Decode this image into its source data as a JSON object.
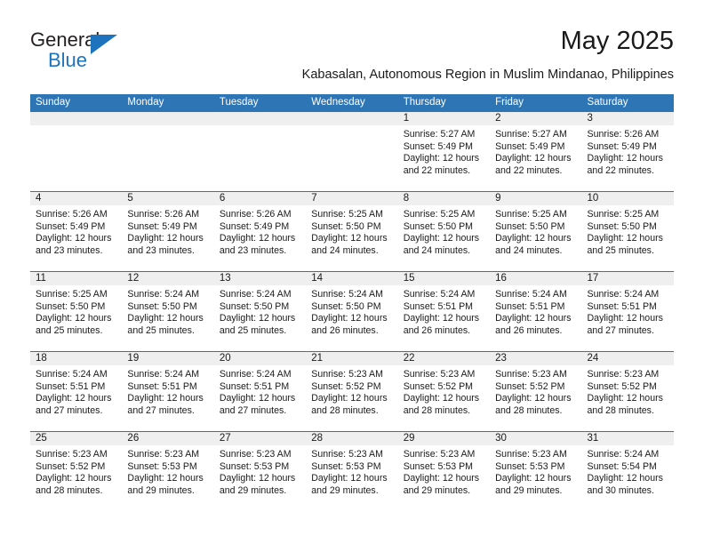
{
  "brand": {
    "name_part1": "General",
    "name_part2": "Blue",
    "accent_color": "#1e73be"
  },
  "header": {
    "title": "May 2025",
    "location": "Kabasalan, Autonomous Region in Muslim Mindanao, Philippines",
    "header_bg_color": "#2e75b6",
    "daynum_bg_color": "#efefef"
  },
  "weekdays": [
    "Sunday",
    "Monday",
    "Tuesday",
    "Wednesday",
    "Thursday",
    "Friday",
    "Saturday"
  ],
  "weeks": [
    [
      {
        "day": "",
        "sunrise": "",
        "sunset": "",
        "daylight1": "",
        "daylight2": ""
      },
      {
        "day": "",
        "sunrise": "",
        "sunset": "",
        "daylight1": "",
        "daylight2": ""
      },
      {
        "day": "",
        "sunrise": "",
        "sunset": "",
        "daylight1": "",
        "daylight2": ""
      },
      {
        "day": "",
        "sunrise": "",
        "sunset": "",
        "daylight1": "",
        "daylight2": ""
      },
      {
        "day": "1",
        "sunrise": "Sunrise: 5:27 AM",
        "sunset": "Sunset: 5:49 PM",
        "daylight1": "Daylight: 12 hours",
        "daylight2": "and 22 minutes."
      },
      {
        "day": "2",
        "sunrise": "Sunrise: 5:27 AM",
        "sunset": "Sunset: 5:49 PM",
        "daylight1": "Daylight: 12 hours",
        "daylight2": "and 22 minutes."
      },
      {
        "day": "3",
        "sunrise": "Sunrise: 5:26 AM",
        "sunset": "Sunset: 5:49 PM",
        "daylight1": "Daylight: 12 hours",
        "daylight2": "and 22 minutes."
      }
    ],
    [
      {
        "day": "4",
        "sunrise": "Sunrise: 5:26 AM",
        "sunset": "Sunset: 5:49 PM",
        "daylight1": "Daylight: 12 hours",
        "daylight2": "and 23 minutes."
      },
      {
        "day": "5",
        "sunrise": "Sunrise: 5:26 AM",
        "sunset": "Sunset: 5:49 PM",
        "daylight1": "Daylight: 12 hours",
        "daylight2": "and 23 minutes."
      },
      {
        "day": "6",
        "sunrise": "Sunrise: 5:26 AM",
        "sunset": "Sunset: 5:49 PM",
        "daylight1": "Daylight: 12 hours",
        "daylight2": "and 23 minutes."
      },
      {
        "day": "7",
        "sunrise": "Sunrise: 5:25 AM",
        "sunset": "Sunset: 5:50 PM",
        "daylight1": "Daylight: 12 hours",
        "daylight2": "and 24 minutes."
      },
      {
        "day": "8",
        "sunrise": "Sunrise: 5:25 AM",
        "sunset": "Sunset: 5:50 PM",
        "daylight1": "Daylight: 12 hours",
        "daylight2": "and 24 minutes."
      },
      {
        "day": "9",
        "sunrise": "Sunrise: 5:25 AM",
        "sunset": "Sunset: 5:50 PM",
        "daylight1": "Daylight: 12 hours",
        "daylight2": "and 24 minutes."
      },
      {
        "day": "10",
        "sunrise": "Sunrise: 5:25 AM",
        "sunset": "Sunset: 5:50 PM",
        "daylight1": "Daylight: 12 hours",
        "daylight2": "and 25 minutes."
      }
    ],
    [
      {
        "day": "11",
        "sunrise": "Sunrise: 5:25 AM",
        "sunset": "Sunset: 5:50 PM",
        "daylight1": "Daylight: 12 hours",
        "daylight2": "and 25 minutes."
      },
      {
        "day": "12",
        "sunrise": "Sunrise: 5:24 AM",
        "sunset": "Sunset: 5:50 PM",
        "daylight1": "Daylight: 12 hours",
        "daylight2": "and 25 minutes."
      },
      {
        "day": "13",
        "sunrise": "Sunrise: 5:24 AM",
        "sunset": "Sunset: 5:50 PM",
        "daylight1": "Daylight: 12 hours",
        "daylight2": "and 25 minutes."
      },
      {
        "day": "14",
        "sunrise": "Sunrise: 5:24 AM",
        "sunset": "Sunset: 5:50 PM",
        "daylight1": "Daylight: 12 hours",
        "daylight2": "and 26 minutes."
      },
      {
        "day": "15",
        "sunrise": "Sunrise: 5:24 AM",
        "sunset": "Sunset: 5:51 PM",
        "daylight1": "Daylight: 12 hours",
        "daylight2": "and 26 minutes."
      },
      {
        "day": "16",
        "sunrise": "Sunrise: 5:24 AM",
        "sunset": "Sunset: 5:51 PM",
        "daylight1": "Daylight: 12 hours",
        "daylight2": "and 26 minutes."
      },
      {
        "day": "17",
        "sunrise": "Sunrise: 5:24 AM",
        "sunset": "Sunset: 5:51 PM",
        "daylight1": "Daylight: 12 hours",
        "daylight2": "and 27 minutes."
      }
    ],
    [
      {
        "day": "18",
        "sunrise": "Sunrise: 5:24 AM",
        "sunset": "Sunset: 5:51 PM",
        "daylight1": "Daylight: 12 hours",
        "daylight2": "and 27 minutes."
      },
      {
        "day": "19",
        "sunrise": "Sunrise: 5:24 AM",
        "sunset": "Sunset: 5:51 PM",
        "daylight1": "Daylight: 12 hours",
        "daylight2": "and 27 minutes."
      },
      {
        "day": "20",
        "sunrise": "Sunrise: 5:24 AM",
        "sunset": "Sunset: 5:51 PM",
        "daylight1": "Daylight: 12 hours",
        "daylight2": "and 27 minutes."
      },
      {
        "day": "21",
        "sunrise": "Sunrise: 5:23 AM",
        "sunset": "Sunset: 5:52 PM",
        "daylight1": "Daylight: 12 hours",
        "daylight2": "and 28 minutes."
      },
      {
        "day": "22",
        "sunrise": "Sunrise: 5:23 AM",
        "sunset": "Sunset: 5:52 PM",
        "daylight1": "Daylight: 12 hours",
        "daylight2": "and 28 minutes."
      },
      {
        "day": "23",
        "sunrise": "Sunrise: 5:23 AM",
        "sunset": "Sunset: 5:52 PM",
        "daylight1": "Daylight: 12 hours",
        "daylight2": "and 28 minutes."
      },
      {
        "day": "24",
        "sunrise": "Sunrise: 5:23 AM",
        "sunset": "Sunset: 5:52 PM",
        "daylight1": "Daylight: 12 hours",
        "daylight2": "and 28 minutes."
      }
    ],
    [
      {
        "day": "25",
        "sunrise": "Sunrise: 5:23 AM",
        "sunset": "Sunset: 5:52 PM",
        "daylight1": "Daylight: 12 hours",
        "daylight2": "and 28 minutes."
      },
      {
        "day": "26",
        "sunrise": "Sunrise: 5:23 AM",
        "sunset": "Sunset: 5:53 PM",
        "daylight1": "Daylight: 12 hours",
        "daylight2": "and 29 minutes."
      },
      {
        "day": "27",
        "sunrise": "Sunrise: 5:23 AM",
        "sunset": "Sunset: 5:53 PM",
        "daylight1": "Daylight: 12 hours",
        "daylight2": "and 29 minutes."
      },
      {
        "day": "28",
        "sunrise": "Sunrise: 5:23 AM",
        "sunset": "Sunset: 5:53 PM",
        "daylight1": "Daylight: 12 hours",
        "daylight2": "and 29 minutes."
      },
      {
        "day": "29",
        "sunrise": "Sunrise: 5:23 AM",
        "sunset": "Sunset: 5:53 PM",
        "daylight1": "Daylight: 12 hours",
        "daylight2": "and 29 minutes."
      },
      {
        "day": "30",
        "sunrise": "Sunrise: 5:23 AM",
        "sunset": "Sunset: 5:53 PM",
        "daylight1": "Daylight: 12 hours",
        "daylight2": "and 29 minutes."
      },
      {
        "day": "31",
        "sunrise": "Sunrise: 5:24 AM",
        "sunset": "Sunset: 5:54 PM",
        "daylight1": "Daylight: 12 hours",
        "daylight2": "and 30 minutes."
      }
    ]
  ]
}
